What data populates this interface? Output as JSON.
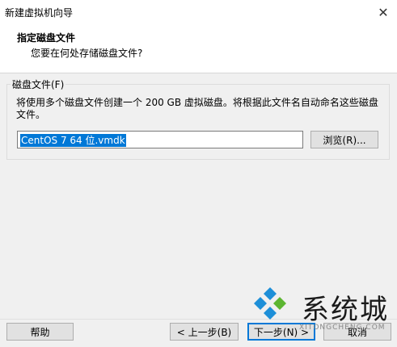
{
  "window": {
    "title": "新建虚拟机向导",
    "close_glyph": "✕"
  },
  "header": {
    "title": "指定磁盘文件",
    "subtitle": "您要在何处存储磁盘文件?"
  },
  "disk_file": {
    "legend": "磁盘文件(F)",
    "description": "将使用多个磁盘文件创建一个 200 GB 虚拟磁盘。将根据此文件名自动命名这些磁盘文件。",
    "value": "CentOS 7 64 位.vmdk",
    "browse_label": "浏览(R)..."
  },
  "footer": {
    "help_label": "帮助",
    "back_label": "< 上一步(B)",
    "next_label": "下一步(N) >",
    "cancel_label": "取消"
  },
  "watermark": {
    "text": "系统城",
    "sub": "XITONGCHENG.COM"
  },
  "colors": {
    "accent": "#0078d7",
    "logo_blue": "#1e8fd8",
    "logo_green": "#5cb531"
  }
}
